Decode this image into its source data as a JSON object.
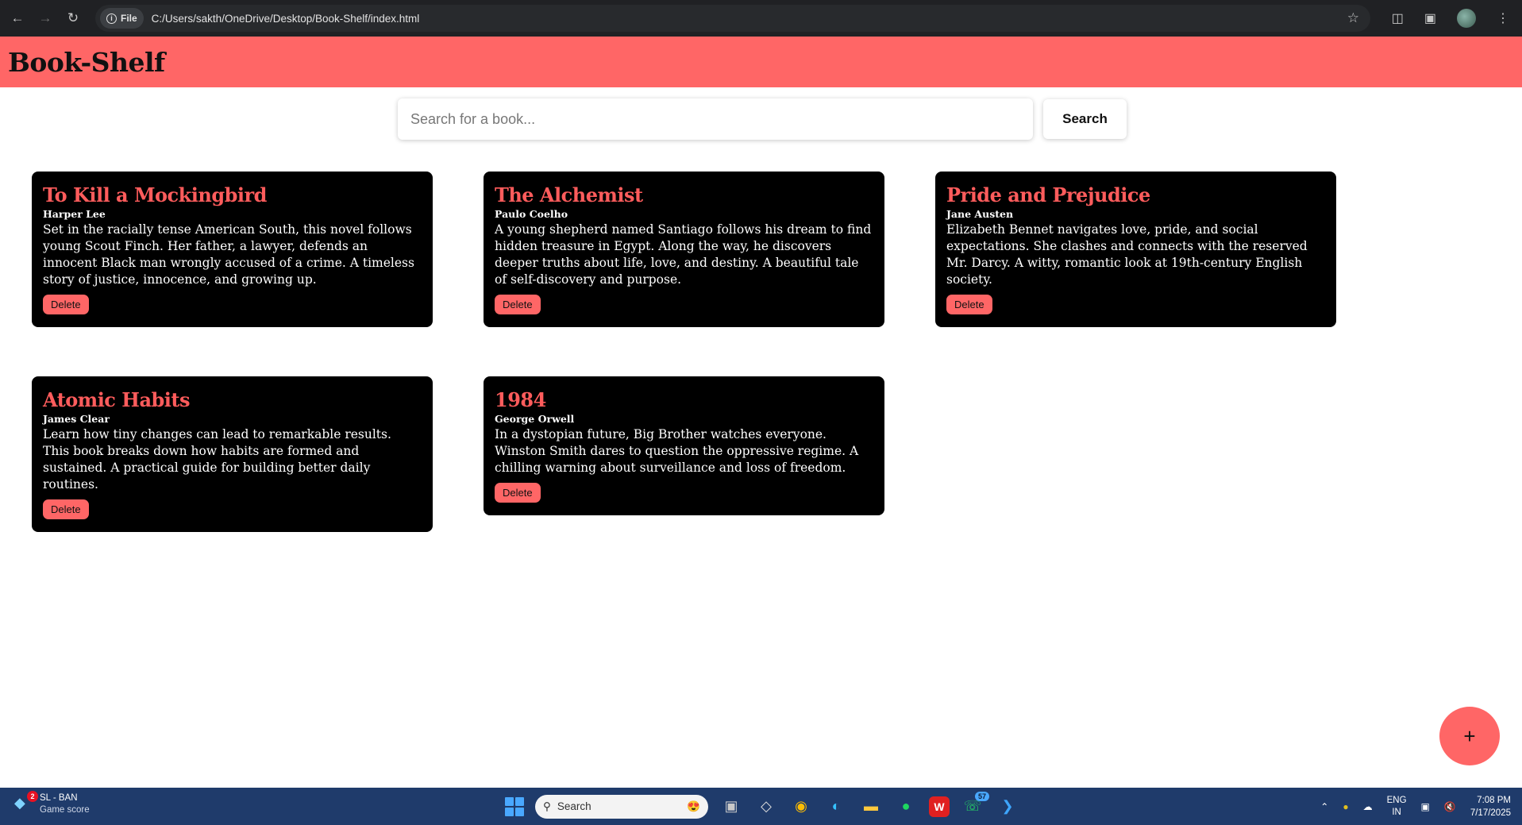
{
  "browser": {
    "file_chip": "File",
    "url": "C:/Users/sakth/OneDrive/Desktop/Book-Shelf/index.html"
  },
  "header": {
    "title": "Book-Shelf"
  },
  "search": {
    "placeholder": "Search for a book...",
    "value": "",
    "button_label": "Search"
  },
  "books": [
    {
      "title": "To Kill a Mockingbird",
      "author": "Harper Lee",
      "description": "Set in the racially tense American South, this novel follows young Scout Finch. Her father, a lawyer, defends an innocent Black man wrongly accused of a crime. A timeless story of justice, innocence, and growing up.",
      "delete_label": "Delete"
    },
    {
      "title": "The Alchemist",
      "author": "Paulo Coelho",
      "description": "A young shepherd named Santiago follows his dream to find hidden treasure in Egypt. Along the way, he discovers deeper truths about life, love, and destiny. A beautiful tale of self-discovery and purpose.",
      "delete_label": "Delete"
    },
    {
      "title": "Pride and Prejudice",
      "author": "Jane Austen",
      "description": "Elizabeth Bennet navigates love, pride, and social expectations. She clashes and connects with the reserved Mr. Darcy. A witty, romantic look at 19th-century English society.",
      "delete_label": "Delete"
    },
    {
      "title": "Atomic Habits",
      "author": "James Clear",
      "description": "Learn how tiny changes can lead to remarkable results. This book breaks down how habits are formed and sustained. A practical guide for building better daily routines.",
      "delete_label": "Delete"
    },
    {
      "title": "1984",
      "author": "George Orwell",
      "description": "In a dystopian future, Big Brother watches everyone. Winston Smith dares to question the oppressive regime. A chilling warning about surveillance and loss of freedom.",
      "delete_label": "Delete"
    }
  ],
  "fab": {
    "label": "+"
  },
  "taskbar": {
    "widget_badge": "2",
    "widget_title": "SL - BAN",
    "widget_subtitle": "Game score",
    "search_label": "Search",
    "whatsapp_badge": "57",
    "lang_top": "ENG",
    "lang_bottom": "IN",
    "time": "7:08 PM",
    "date": "7/17/2025"
  },
  "colors": {
    "accent": "#ff6666",
    "card_bg": "#000000",
    "card_title": "#ff5c5c",
    "taskbar": "#1f3b6b"
  }
}
